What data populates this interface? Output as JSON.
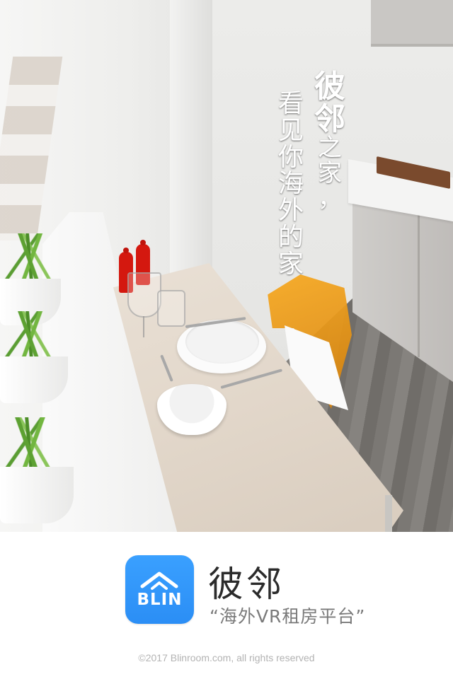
{
  "slogan": {
    "col_a": [
      "看",
      "见",
      "你",
      "海",
      "外",
      "的",
      "家"
    ],
    "col_b": [
      "彼",
      "邻",
      "之",
      "家",
      "，"
    ]
  },
  "brand": {
    "logo_text": "BLIN",
    "app_name": "彼邻",
    "tagline": "“海外VR租房平台”"
  },
  "footer": {
    "copyright": "©2017 Blinroom.com, all rights reserved"
  },
  "colors": {
    "brand_blue": "#3aa0ff",
    "chair_orange": "#f0a020"
  }
}
